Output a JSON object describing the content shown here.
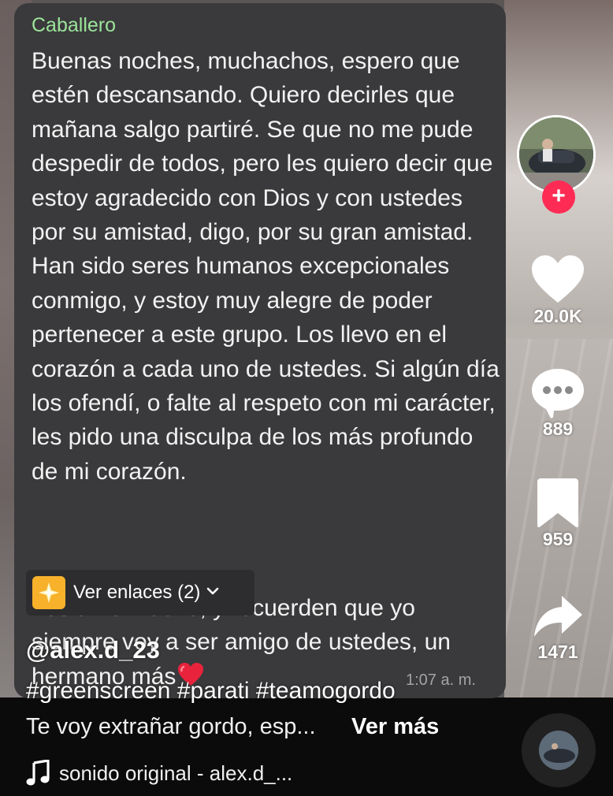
{
  "chat": {
    "sender": "Caballero",
    "message": "Buenas noches, muchachos, espero que estén descansando. Quiero decirles que mañana salgo partiré. Se que no me pude despedir de todos, pero les quiero decir que estoy agradecido con Dios y con ustedes por su amistad, digo, por su gran amistad. Han sido seres humanos excepcionales conmigo, y estoy muy alegre de poder pertenecer a este grupo. Los llevo en el corazón a cada uno de ustedes. Si algún día los ofendí, o falte al respeto con mi carácter, les pido una disculpa de los más profundo de mi corazón.",
    "message_tail": "Los amo mucho, y recuerden que yo siempre voy a ser amigo de ustedes, un hermano más",
    "time": "1:07 a. m.",
    "links_label": "Ver enlaces (2)"
  },
  "video": {
    "username": "@alex.d_23",
    "hashtags": "#greenscreen #parati #teamogordo",
    "caption": "Te voy extrañar gordo, esp...",
    "see_more": "Ver más",
    "sound": "sonido original - alex.d_..."
  },
  "actions": {
    "likes": "20.0K",
    "comments": "889",
    "saves": "959",
    "shares": "1471",
    "follow_symbol": "+"
  },
  "colors": {
    "sender_name": "#9ce49a",
    "follow_button": "#fe2c55",
    "bubble": "#3a3a3c"
  },
  "icons": [
    "heart-icon",
    "comment-icon",
    "bookmark-icon",
    "share-icon",
    "music-note-icon",
    "sparkle-icon",
    "chevron-down-icon"
  ]
}
